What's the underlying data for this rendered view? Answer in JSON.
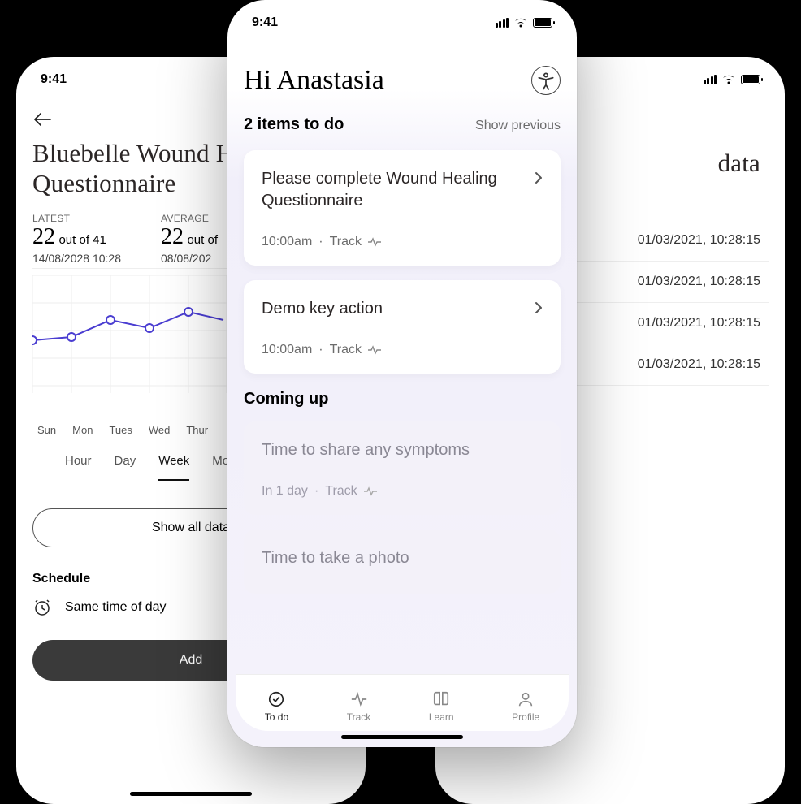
{
  "status_time": "9:41",
  "left": {
    "title": "Bluebelle Wound Healing Questionnaire",
    "title_line1": "Bluebelle Wound H",
    "title_line2": "Questionnaire",
    "latest_label": "LATEST",
    "latest_value": "22",
    "latest_of": "out of 41",
    "latest_date": "14/08/2028 10:28",
    "avg_label": "AVERAGE",
    "avg_value": "22",
    "avg_of": "out of",
    "avg_date": "08/08/202",
    "days": [
      "Sun",
      "Mon",
      "Tues",
      "Wed",
      "Thur"
    ],
    "range_tabs": [
      "Hour",
      "Day",
      "Week",
      "Mo"
    ],
    "range_active": "Week",
    "show_all": "Show all data",
    "schedule_label": "Schedule",
    "schedule_text": "Same time of day",
    "add": "Add"
  },
  "chart_data": {
    "type": "line",
    "x": [
      "Sun",
      "Mon",
      "Tues",
      "Wed",
      "Thur"
    ],
    "values": [
      20,
      21,
      25,
      23,
      27
    ],
    "ylim": [
      0,
      41
    ],
    "color": "#4a3dd1"
  },
  "center": {
    "greeting": "Hi Anastasia",
    "count_label": "2 items to do",
    "show_prev": "Show previous",
    "todo": [
      {
        "title": "Please complete Wound Healing Questionnaire",
        "time": "10:00am",
        "cat": "Track"
      },
      {
        "title": "Demo key action",
        "time": "10:00am",
        "cat": "Track"
      }
    ],
    "coming_label": "Coming up",
    "coming": [
      {
        "title": "Time to share any symptoms",
        "when": "In 1 day",
        "cat": "Track"
      },
      {
        "title": "Time to take a photo",
        "when": "",
        "cat": ""
      }
    ],
    "tabs": [
      "To do",
      "Track",
      "Learn",
      "Profile"
    ]
  },
  "right": {
    "title_frag": "data",
    "rows": [
      "01/03/2021, 10:28:15",
      "01/03/2021, 10:28:15",
      "01/03/2021, 10:28:15",
      "01/03/2021, 10:28:15"
    ]
  }
}
